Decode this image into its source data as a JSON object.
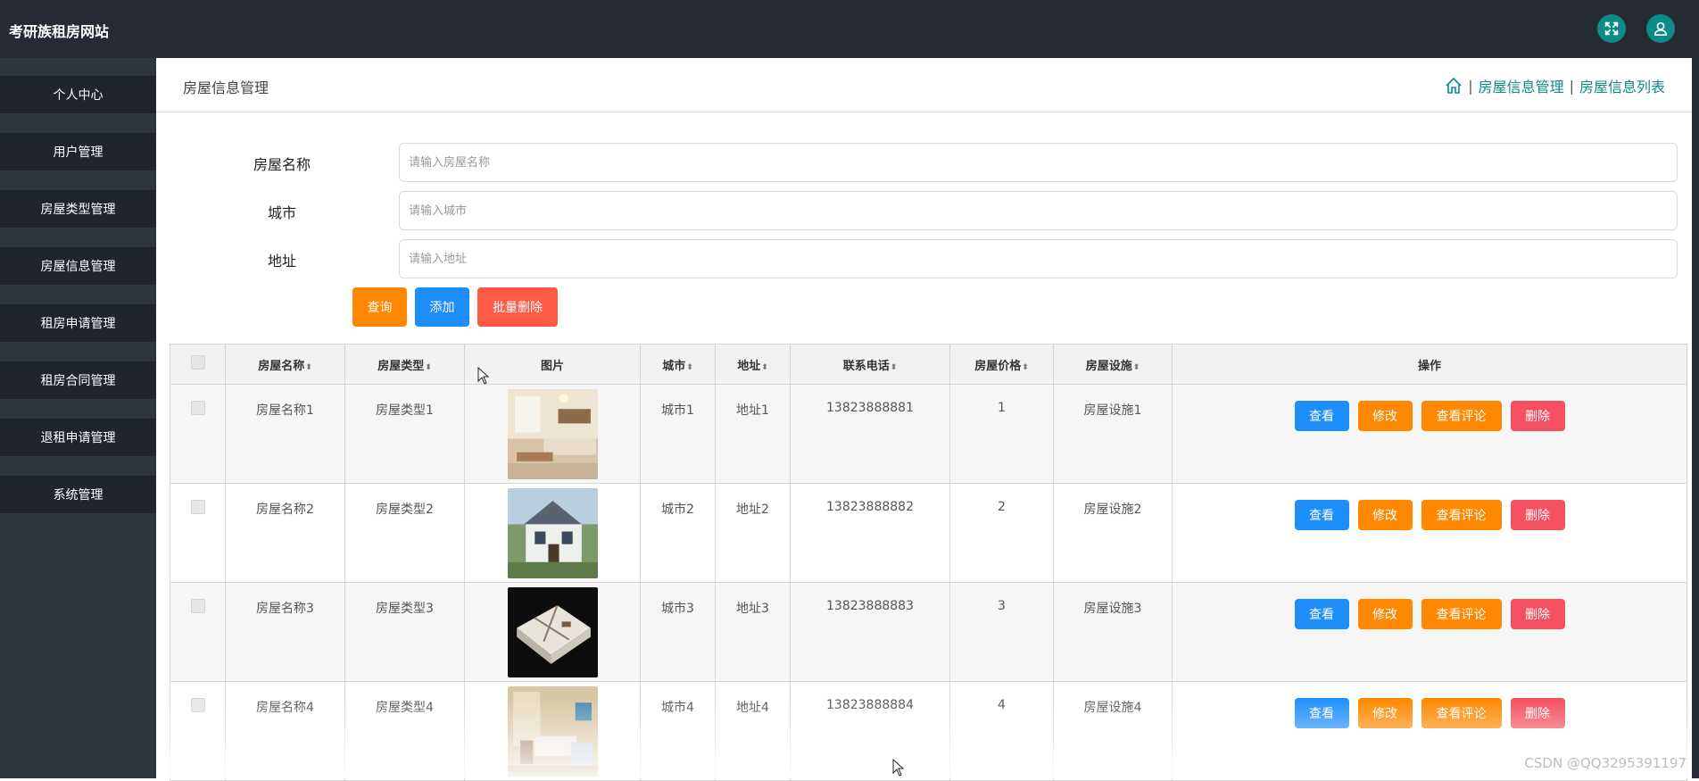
{
  "app": {
    "title": "考研族租房网站",
    "accent": "#0d8c87",
    "icons": [
      "fullscreen-icon",
      "user-icon"
    ]
  },
  "sidebar": {
    "items": [
      {
        "label": "个人中心"
      },
      {
        "label": "用户管理"
      },
      {
        "label": "房屋类型管理"
      },
      {
        "label": "房屋信息管理"
      },
      {
        "label": "租房申请管理"
      },
      {
        "label": "租房合同管理"
      },
      {
        "label": "退租申请管理"
      },
      {
        "label": "系统管理"
      }
    ]
  },
  "header": {
    "page_title": "房屋信息管理",
    "breadcrumb": [
      "房屋信息管理",
      "房屋信息列表"
    ],
    "breadcrumb_separator": "|"
  },
  "search": {
    "fields": [
      {
        "label": "房屋名称",
        "value": "",
        "placeholder": "请输入房屋名称"
      },
      {
        "label": "城市",
        "value": "",
        "placeholder": "请输入城市"
      },
      {
        "label": "地址",
        "value": "",
        "placeholder": "请输入地址"
      }
    ],
    "buttons": {
      "query": "查询",
      "add": "添加",
      "batch_delete": "批量删除"
    }
  },
  "table": {
    "columns": [
      "房屋名称",
      "房屋类型",
      "图片",
      "城市",
      "地址",
      "联系电话",
      "房屋价格",
      "房屋设施",
      "操作"
    ],
    "sort_glyph": "⬍",
    "rows": [
      {
        "name": "房屋名称1",
        "type": "房屋类型1",
        "image": "living-room-photo",
        "city": "城市1",
        "address": "地址1",
        "phone": "13823888881",
        "price": "1",
        "facility": "房屋设施1"
      },
      {
        "name": "房屋名称2",
        "type": "房屋类型2",
        "image": "house-exterior-photo",
        "city": "城市2",
        "address": "地址2",
        "phone": "13823888882",
        "price": "2",
        "facility": "房屋设施2"
      },
      {
        "name": "房屋名称3",
        "type": "房屋类型3",
        "image": "floorplan-3d-photo",
        "city": "城市3",
        "address": "地址3",
        "phone": "13823888883",
        "price": "3",
        "facility": "房屋设施3"
      },
      {
        "name": "房屋名称4",
        "type": "房屋类型4",
        "image": "bedroom-photo",
        "city": "城市4",
        "address": "地址4",
        "phone": "13823888884",
        "price": "4",
        "facility": "房屋设施4"
      }
    ],
    "actions": {
      "view": "查看",
      "edit": "修改",
      "comments": "查看评论",
      "delete": "删除"
    }
  },
  "colors": {
    "topbar": "#252a34",
    "sidebar": "#2f3541",
    "sidebar_item": "#1f242d",
    "btn_orange": "#ff8800",
    "btn_blue": "#1e8ffa",
    "btn_red": "#ff5a45",
    "btn_delete": "#f5505f"
  },
  "watermark": "CSDN @QQ3295391197"
}
